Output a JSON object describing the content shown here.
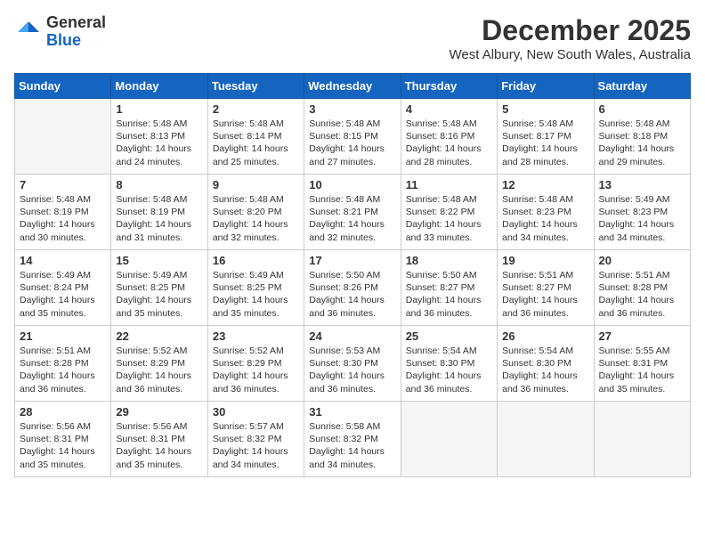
{
  "header": {
    "logo_general": "General",
    "logo_blue": "Blue",
    "month_title": "December 2025",
    "location": "West Albury, New South Wales, Australia"
  },
  "days_of_week": [
    "Sunday",
    "Monday",
    "Tuesday",
    "Wednesday",
    "Thursday",
    "Friday",
    "Saturday"
  ],
  "weeks": [
    [
      {
        "day": "",
        "info": ""
      },
      {
        "day": "1",
        "info": "Sunrise: 5:48 AM\nSunset: 8:13 PM\nDaylight: 14 hours\nand 24 minutes."
      },
      {
        "day": "2",
        "info": "Sunrise: 5:48 AM\nSunset: 8:14 PM\nDaylight: 14 hours\nand 25 minutes."
      },
      {
        "day": "3",
        "info": "Sunrise: 5:48 AM\nSunset: 8:15 PM\nDaylight: 14 hours\nand 27 minutes."
      },
      {
        "day": "4",
        "info": "Sunrise: 5:48 AM\nSunset: 8:16 PM\nDaylight: 14 hours\nand 28 minutes."
      },
      {
        "day": "5",
        "info": "Sunrise: 5:48 AM\nSunset: 8:17 PM\nDaylight: 14 hours\nand 28 minutes."
      },
      {
        "day": "6",
        "info": "Sunrise: 5:48 AM\nSunset: 8:18 PM\nDaylight: 14 hours\nand 29 minutes."
      }
    ],
    [
      {
        "day": "7",
        "info": "Sunrise: 5:48 AM\nSunset: 8:19 PM\nDaylight: 14 hours\nand 30 minutes."
      },
      {
        "day": "8",
        "info": "Sunrise: 5:48 AM\nSunset: 8:19 PM\nDaylight: 14 hours\nand 31 minutes."
      },
      {
        "day": "9",
        "info": "Sunrise: 5:48 AM\nSunset: 8:20 PM\nDaylight: 14 hours\nand 32 minutes."
      },
      {
        "day": "10",
        "info": "Sunrise: 5:48 AM\nSunset: 8:21 PM\nDaylight: 14 hours\nand 32 minutes."
      },
      {
        "day": "11",
        "info": "Sunrise: 5:48 AM\nSunset: 8:22 PM\nDaylight: 14 hours\nand 33 minutes."
      },
      {
        "day": "12",
        "info": "Sunrise: 5:48 AM\nSunset: 8:23 PM\nDaylight: 14 hours\nand 34 minutes."
      },
      {
        "day": "13",
        "info": "Sunrise: 5:49 AM\nSunset: 8:23 PM\nDaylight: 14 hours\nand 34 minutes."
      }
    ],
    [
      {
        "day": "14",
        "info": "Sunrise: 5:49 AM\nSunset: 8:24 PM\nDaylight: 14 hours\nand 35 minutes."
      },
      {
        "day": "15",
        "info": "Sunrise: 5:49 AM\nSunset: 8:25 PM\nDaylight: 14 hours\nand 35 minutes."
      },
      {
        "day": "16",
        "info": "Sunrise: 5:49 AM\nSunset: 8:25 PM\nDaylight: 14 hours\nand 35 minutes."
      },
      {
        "day": "17",
        "info": "Sunrise: 5:50 AM\nSunset: 8:26 PM\nDaylight: 14 hours\nand 36 minutes."
      },
      {
        "day": "18",
        "info": "Sunrise: 5:50 AM\nSunset: 8:27 PM\nDaylight: 14 hours\nand 36 minutes."
      },
      {
        "day": "19",
        "info": "Sunrise: 5:51 AM\nSunset: 8:27 PM\nDaylight: 14 hours\nand 36 minutes."
      },
      {
        "day": "20",
        "info": "Sunrise: 5:51 AM\nSunset: 8:28 PM\nDaylight: 14 hours\nand 36 minutes."
      }
    ],
    [
      {
        "day": "21",
        "info": "Sunrise: 5:51 AM\nSunset: 8:28 PM\nDaylight: 14 hours\nand 36 minutes."
      },
      {
        "day": "22",
        "info": "Sunrise: 5:52 AM\nSunset: 8:29 PM\nDaylight: 14 hours\nand 36 minutes."
      },
      {
        "day": "23",
        "info": "Sunrise: 5:52 AM\nSunset: 8:29 PM\nDaylight: 14 hours\nand 36 minutes."
      },
      {
        "day": "24",
        "info": "Sunrise: 5:53 AM\nSunset: 8:30 PM\nDaylight: 14 hours\nand 36 minutes."
      },
      {
        "day": "25",
        "info": "Sunrise: 5:54 AM\nSunset: 8:30 PM\nDaylight: 14 hours\nand 36 minutes."
      },
      {
        "day": "26",
        "info": "Sunrise: 5:54 AM\nSunset: 8:30 PM\nDaylight: 14 hours\nand 36 minutes."
      },
      {
        "day": "27",
        "info": "Sunrise: 5:55 AM\nSunset: 8:31 PM\nDaylight: 14 hours\nand 35 minutes."
      }
    ],
    [
      {
        "day": "28",
        "info": "Sunrise: 5:56 AM\nSunset: 8:31 PM\nDaylight: 14 hours\nand 35 minutes."
      },
      {
        "day": "29",
        "info": "Sunrise: 5:56 AM\nSunset: 8:31 PM\nDaylight: 14 hours\nand 35 minutes."
      },
      {
        "day": "30",
        "info": "Sunrise: 5:57 AM\nSunset: 8:32 PM\nDaylight: 14 hours\nand 34 minutes."
      },
      {
        "day": "31",
        "info": "Sunrise: 5:58 AM\nSunset: 8:32 PM\nDaylight: 14 hours\nand 34 minutes."
      },
      {
        "day": "",
        "info": ""
      },
      {
        "day": "",
        "info": ""
      },
      {
        "day": "",
        "info": ""
      }
    ]
  ]
}
